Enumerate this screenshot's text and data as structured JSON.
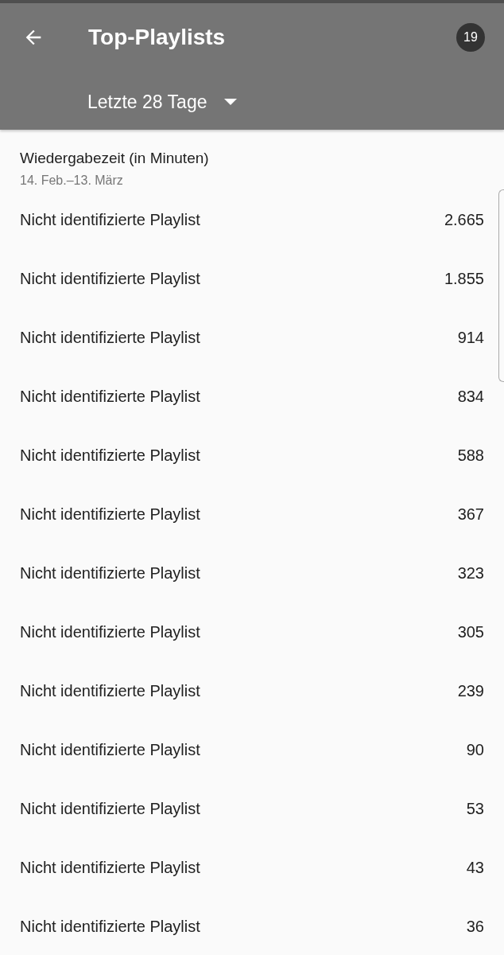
{
  "header": {
    "title": "Top-Playlists",
    "badge": "19",
    "period": "Letzte 28 Tage"
  },
  "section": {
    "title": "Wiedergabezeit (in Minuten)",
    "date_range": "14. Feb.–13. März"
  },
  "rows": [
    {
      "name": "Nicht identifizierte Playlist",
      "value": "2.665"
    },
    {
      "name": "Nicht identifizierte Playlist",
      "value": "1.855"
    },
    {
      "name": "Nicht identifizierte Playlist",
      "value": "914"
    },
    {
      "name": "Nicht identifizierte Playlist",
      "value": "834"
    },
    {
      "name": "Nicht identifizierte Playlist",
      "value": "588"
    },
    {
      "name": "Nicht identifizierte Playlist",
      "value": "367"
    },
    {
      "name": "Nicht identifizierte Playlist",
      "value": "323"
    },
    {
      "name": "Nicht identifizierte Playlist",
      "value": "305"
    },
    {
      "name": "Nicht identifizierte Playlist",
      "value": "239"
    },
    {
      "name": "Nicht identifizierte Playlist",
      "value": "90"
    },
    {
      "name": "Nicht identifizierte Playlist",
      "value": "53"
    },
    {
      "name": "Nicht identifizierte Playlist",
      "value": "43"
    },
    {
      "name": "Nicht identifizierte Playlist",
      "value": "36"
    }
  ]
}
